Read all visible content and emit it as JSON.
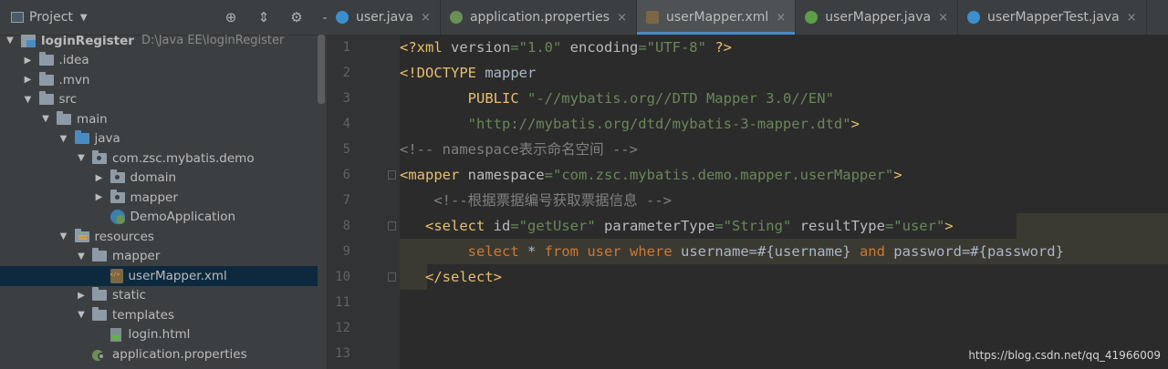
{
  "project_panel": {
    "title": "Project",
    "tools": [
      "⊕",
      "⇕",
      "⚙",
      "—"
    ]
  },
  "tree": [
    {
      "label": "loginRegister",
      "path": "D:\\Java EE\\loginRegister",
      "level": 0,
      "arrow": "▼",
      "icon": "project"
    },
    {
      "label": ".idea",
      "level": 1,
      "arrow": "▶",
      "icon": "folder"
    },
    {
      "label": ".mvn",
      "level": 1,
      "arrow": "▶",
      "icon": "folder"
    },
    {
      "label": "src",
      "level": 1,
      "arrow": "▼",
      "icon": "folder"
    },
    {
      "label": "main",
      "level": 2,
      "arrow": "▼",
      "icon": "folder"
    },
    {
      "label": "java",
      "level": 3,
      "arrow": "▼",
      "icon": "folder-blue"
    },
    {
      "label": "com.zsc.mybatis.demo",
      "level": 4,
      "arrow": "▼",
      "icon": "package"
    },
    {
      "label": "domain",
      "level": 5,
      "arrow": "▶",
      "icon": "package"
    },
    {
      "label": "mapper",
      "level": 5,
      "arrow": "▶",
      "icon": "package"
    },
    {
      "label": "DemoApplication",
      "level": 5,
      "arrow": "",
      "icon": "app"
    },
    {
      "label": "resources",
      "level": 3,
      "arrow": "▼",
      "icon": "resources"
    },
    {
      "label": "mapper",
      "level": 4,
      "arrow": "▼",
      "icon": "folder"
    },
    {
      "label": "userMapper.xml",
      "level": 5,
      "arrow": "",
      "icon": "xml",
      "selected": true
    },
    {
      "label": "static",
      "level": 4,
      "arrow": "▶",
      "icon": "folder"
    },
    {
      "label": "templates",
      "level": 4,
      "arrow": "▼",
      "icon": "folder"
    },
    {
      "label": "login.html",
      "level": 5,
      "arrow": "",
      "icon": "html"
    },
    {
      "label": "application.properties",
      "level": 4,
      "arrow": "",
      "icon": "props"
    }
  ],
  "tabs": [
    {
      "label": "user.java",
      "icon": "c",
      "active": false
    },
    {
      "label": "application.properties",
      "icon": "props",
      "active": false
    },
    {
      "label": "userMapper.xml",
      "icon": "xml",
      "active": true
    },
    {
      "label": "userMapper.java",
      "icon": "i",
      "active": false
    },
    {
      "label": "userMapperTest.java",
      "icon": "t",
      "active": false
    }
  ],
  "tab_close": "×",
  "line_numbers": [
    "1",
    "2",
    "3",
    "4",
    "5",
    "6",
    "7",
    "8",
    "9",
    "10",
    "11",
    "12",
    "13"
  ],
  "code_lines": [
    [
      [
        "k",
        "<?xml "
      ],
      [
        "a",
        "version"
      ],
      [
        "s",
        "=\"1.0\" "
      ],
      [
        "a",
        "encoding"
      ],
      [
        "s",
        "=\"UTF-8\" "
      ],
      [
        "k",
        "?>"
      ]
    ],
    [
      [
        "k",
        "<!DOCTYPE "
      ],
      [
        "d",
        "mapper"
      ]
    ],
    [
      [
        "d",
        "        "
      ],
      [
        "k",
        "PUBLIC "
      ],
      [
        "s",
        "\"-//mybatis.org//DTD Mapper 3.0//EN\""
      ]
    ],
    [
      [
        "d",
        "        "
      ],
      [
        "s",
        "\"http://mybatis.org/dtd/mybatis-3-mapper.dtd\""
      ],
      [
        "k",
        ">"
      ]
    ],
    [
      [
        "cm",
        "<!-- namespace表示命名空间 -->"
      ]
    ],
    [
      [
        "k",
        "<mapper "
      ],
      [
        "a",
        "namespace"
      ],
      [
        "s",
        "=\"com.zsc.mybatis.demo.mapper.userMapper\""
      ],
      [
        "k",
        ">"
      ]
    ],
    [
      [
        "d",
        "    "
      ],
      [
        "cm",
        "<!--根据票据编号获取票据信息 -->"
      ]
    ],
    [
      [
        "d",
        "   "
      ],
      [
        "k",
        "<select "
      ],
      [
        "a",
        "id"
      ],
      [
        "s",
        "=\"getUser\" "
      ],
      [
        "a",
        "parameterType"
      ],
      [
        "s",
        "=\"String\" "
      ],
      [
        "a",
        "resultType"
      ],
      [
        "s",
        "=\"user\""
      ],
      [
        "k",
        ">"
      ]
    ],
    [
      [
        "d",
        "        "
      ],
      [
        "sql",
        "select "
      ],
      [
        "d",
        "* "
      ],
      [
        "sql",
        "from "
      ],
      [
        "sql",
        "user "
      ],
      [
        "sql",
        "where "
      ],
      [
        "d",
        "username=#{username} "
      ],
      [
        "sql",
        "and "
      ],
      [
        "d",
        "password=#{password}"
      ]
    ],
    [
      [
        "d",
        "   "
      ],
      [
        "k",
        "</select>"
      ]
    ],
    [],
    [],
    []
  ],
  "watermark": "https://blog.csdn.net/qq_41966009"
}
